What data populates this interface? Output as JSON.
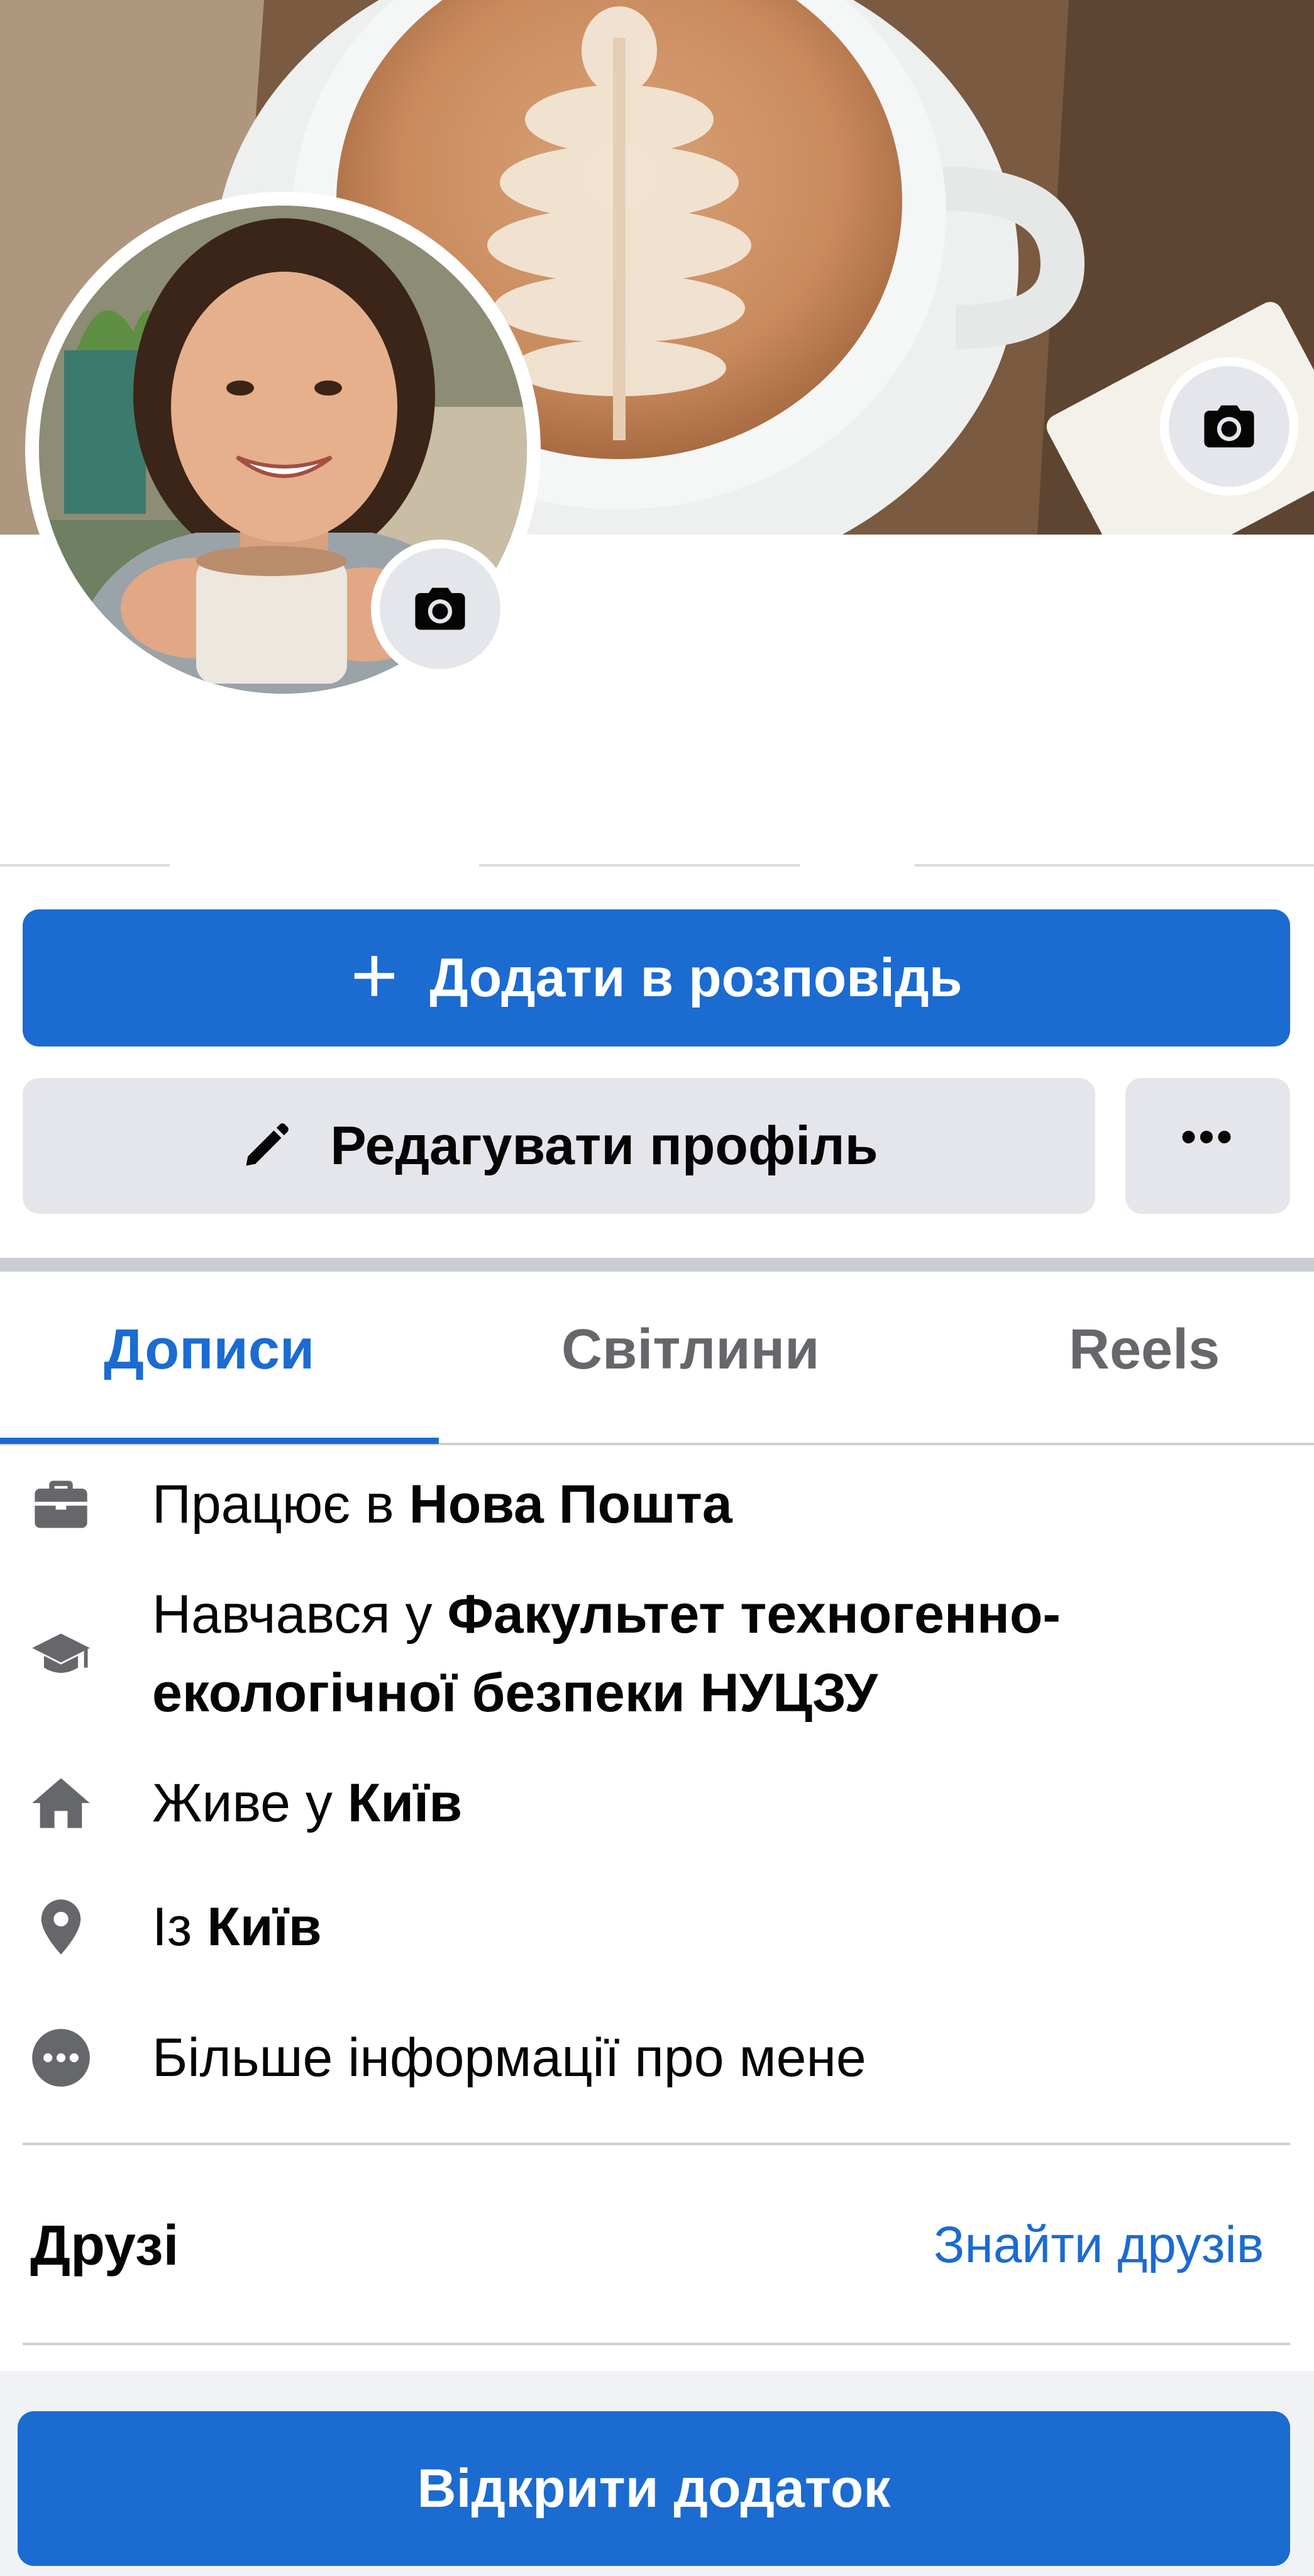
{
  "cover": {
    "camera_icon": "camera-icon"
  },
  "avatar": {
    "camera_icon": "camera-icon"
  },
  "actions": {
    "add_story_label": "Додати в розповідь",
    "add_story_icon": "plus-icon",
    "edit_profile_label": "Редагувати профіль",
    "edit_profile_icon": "pencil-icon",
    "more_label": "•••"
  },
  "tabs": [
    {
      "label": "Дописи",
      "active": true
    },
    {
      "label": "Світлини",
      "active": false
    },
    {
      "label": "Reels",
      "active": false
    }
  ],
  "intro": {
    "work": {
      "prefix": "Працює в ",
      "value": "Нова Пошта",
      "icon": "briefcase-icon"
    },
    "education": {
      "prefix": "Навчався у ",
      "value": "Факультет техногенно-екологічної безпеки НУЦЗУ",
      "icon": "graduation-cap-icon"
    },
    "lives": {
      "prefix": "Живе у ",
      "value": "Київ",
      "icon": "home-icon"
    },
    "from": {
      "prefix": "Із ",
      "value": "Київ",
      "icon": "location-pin-icon"
    },
    "more": {
      "label": "Більше інформації про мене",
      "icon": "more-dots-icon"
    }
  },
  "friends": {
    "title": "Друзі",
    "find_link": "Знайти друзів"
  },
  "footer": {
    "open_app_label": "Відкрити додаток"
  },
  "colors": {
    "accent": "#1b6bd1",
    "button_gray": "#e4e6eb",
    "secondary_text": "#65676b"
  }
}
